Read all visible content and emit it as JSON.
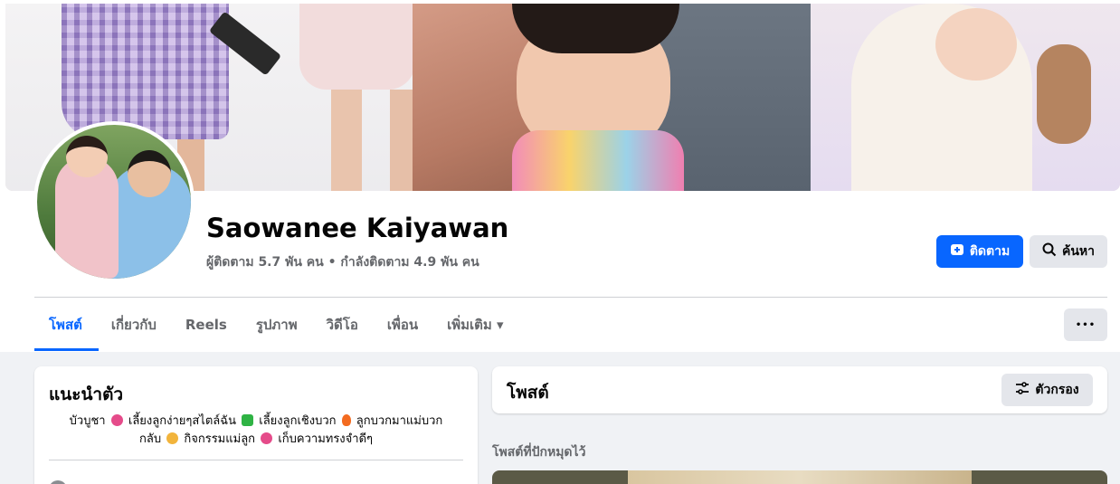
{
  "profile": {
    "name": "Saowanee Kaiyawan",
    "stats": "ผู้ติดตาม 5.7 พัน คน • กำลังติดตาม 4.9 พัน คน"
  },
  "actions": {
    "follow_label": "ติดตาม",
    "search_label": "ค้นหา",
    "more_label": "•••"
  },
  "tabs": [
    {
      "label": "โพสต์",
      "active": true
    },
    {
      "label": "เกี่ยวกับ"
    },
    {
      "label": "Reels"
    },
    {
      "label": "รูปภาพ"
    },
    {
      "label": "วิดีโอ"
    },
    {
      "label": "เพื่อน"
    },
    {
      "label": "เพิ่มเติม ▾"
    }
  ],
  "intro": {
    "title": "แนะนำตัว",
    "bio_line1_a": "บัวบูชา",
    "bio_line1_b": "เลี้ยงลูกง่ายๆสไตล์ฉัน",
    "bio_line1_c": "เลี้ยงลูกเชิงบวก",
    "bio_line1_d": "ลูกบวกมาแม่บวก",
    "bio_line2_a": "กลับ",
    "bio_line2_b": "กิจกรรมแม่ลูก",
    "bio_line2_c": "เก็บความทรงจำดีๆ"
  },
  "posts": {
    "title": "โพสต์",
    "filter_label": "ตัวกรอง",
    "pinned_label": "โพสต์ที่ปักหมุดไว้"
  },
  "colors": {
    "accent": "#0866ff",
    "bg": "#f0f2f5"
  }
}
